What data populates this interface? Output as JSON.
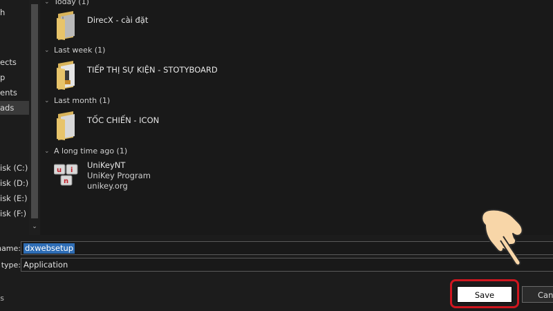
{
  "sidebar": {
    "items": [
      {
        "label": "h",
        "selected": false
      },
      {
        "label": "ects",
        "selected": false
      },
      {
        "label": "p",
        "selected": false
      },
      {
        "label": "ents",
        "selected": false
      },
      {
        "label": "ads",
        "selected": true
      },
      {
        "label": "isk (C:)",
        "selected": false
      },
      {
        "label": "isk (D:)",
        "selected": false
      },
      {
        "label": "isk (E:)",
        "selected": false
      },
      {
        "label": "isk (F:)",
        "selected": false
      }
    ]
  },
  "groups": [
    {
      "header": "Today (1)",
      "items": [
        {
          "name": "DirecX - cài đặt",
          "icon": "folder-icon"
        }
      ]
    },
    {
      "header": "Last week (1)",
      "items": [
        {
          "name": "TIẾP THỊ SỰ KIỆN - STOTYBOARD",
          "icon": "folder-icon"
        }
      ]
    },
    {
      "header": "Last month (1)",
      "items": [
        {
          "name": "TỐC CHIẾN - ICON",
          "icon": "folder-icon"
        }
      ]
    },
    {
      "header": "A long time ago (1)",
      "items": [
        {
          "name": "UniKeyNT",
          "line2": "UniKey Program",
          "line3": "unikey.org",
          "icon": "unikey-app-icon"
        }
      ]
    }
  ],
  "footer": {
    "filename_label": "name:",
    "filename_value": "dxwebsetup",
    "filetype_label": "type:",
    "filetype_value": "Application",
    "hide_folders_label": "s",
    "save_label": "Save",
    "cancel_label": "Canc"
  },
  "colors": {
    "highlight": "#d0161f",
    "selection": "#2e6db5",
    "folder": "#e8c46a"
  }
}
